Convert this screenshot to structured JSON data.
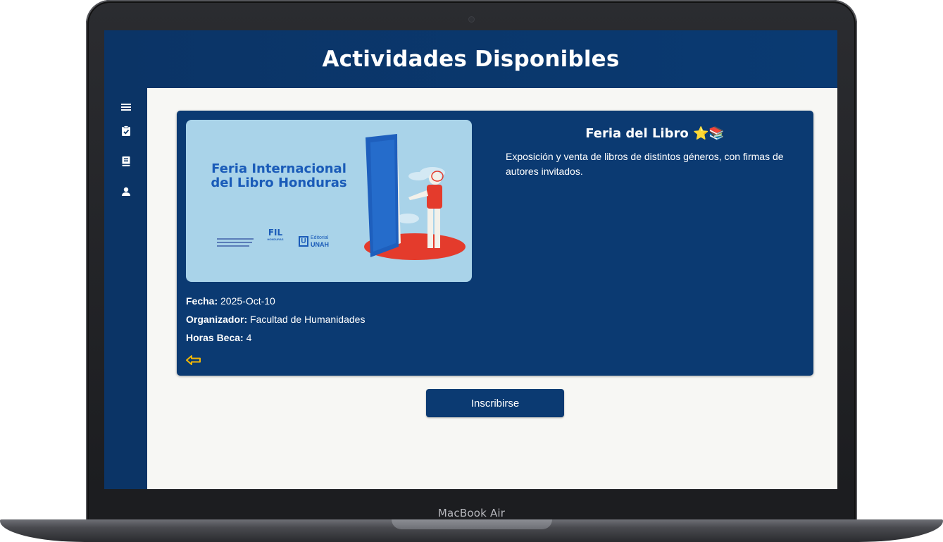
{
  "device": {
    "brand_label": "MacBook Air"
  },
  "header": {
    "title": "Actividades Disponibles"
  },
  "sidebar": {
    "items": [
      {
        "icon": "menu-icon"
      },
      {
        "icon": "clipboard-check-icon"
      },
      {
        "icon": "book-icon"
      },
      {
        "icon": "user-icon"
      }
    ]
  },
  "activity": {
    "title": "Feria del Libro ⭐📚",
    "description": "Exposición y venta de libros de distintos géneros, con firmas de autores invitados.",
    "image": {
      "heading_line1": "Feria Internacional",
      "heading_line2": "del Libro Honduras",
      "logo_fil": "FIL",
      "logo_fil_sub": "HONDURAS",
      "logo_editorial_mark": "U",
      "logo_editorial_line1": "Editorial",
      "logo_editorial_line2": "UNAH"
    },
    "fecha_label": "Fecha:",
    "fecha_value": "2025-Oct-10",
    "organizador_label": "Organizador:",
    "organizador_value": "Facultad de Humanidades",
    "horas_label": "Horas Beca:",
    "horas_value": "4"
  },
  "actions": {
    "enroll_label": "Inscribirse"
  },
  "colors": {
    "primary": "#0b3a72",
    "header": "#0b3466",
    "background": "#f7f7f4",
    "accent": "#f2b705"
  }
}
